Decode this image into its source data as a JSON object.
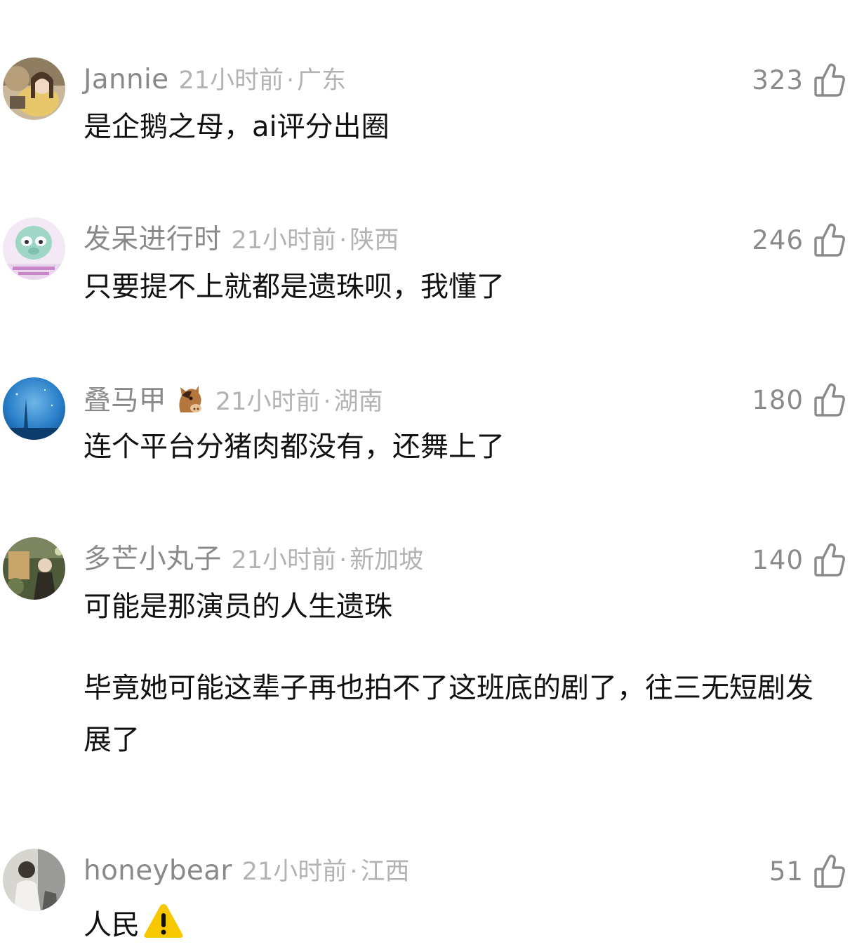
{
  "comments": [
    {
      "username": "Jannie",
      "time": "21小时前",
      "separator": "·",
      "region": "广东",
      "likes": "323",
      "text": "是企鹅之母，ai评分出圈",
      "avatar_colors": [
        "#c9b89c",
        "#e8c66a",
        "#6b5a48"
      ]
    },
    {
      "username": "发呆进行时",
      "time": "21小时前",
      "separator": "·",
      "region": "陕西",
      "likes": "246",
      "text": "只要提不上就都是遗珠呗，我懂了",
      "avatar_colors": [
        "#f3e9f5",
        "#9fd6c5",
        "#c887c9"
      ]
    },
    {
      "username": "叠马甲",
      "username_emoji": "horse-face-icon",
      "time": "21小时前",
      "separator": "·",
      "region": "湖南",
      "likes": "180",
      "text": "连个平台分猪肉都没有，还舞上了",
      "avatar_colors": [
        "#2a7fc9",
        "#6fb6e6",
        "#0f4f8a"
      ]
    },
    {
      "username": "多芒小丸子",
      "time": "21小时前",
      "separator": "·",
      "region": "新加坡",
      "likes": "140",
      "text_lines": [
        "可能是那演员的人生遗珠",
        "毕竟她可能这辈子再也拍不了这班底的剧了，往三无短剧发展了"
      ],
      "avatar_colors": [
        "#4f5a3a",
        "#c7a56b",
        "#2e2b24"
      ]
    },
    {
      "username": "honeybear",
      "time": "21小时前",
      "separator": "·",
      "region": "江西",
      "likes": "51",
      "text": "人民",
      "text_emoji": "warning-icon",
      "avatar_colors": [
        "#9a9a98",
        "#d7d5d0",
        "#5a5a58"
      ]
    }
  ],
  "colors": {
    "username": "#8a8a8a",
    "meta": "#b3b3b3",
    "body_text": "#111111",
    "like_icon": "#8a8a8a",
    "background": "#ffffff"
  }
}
